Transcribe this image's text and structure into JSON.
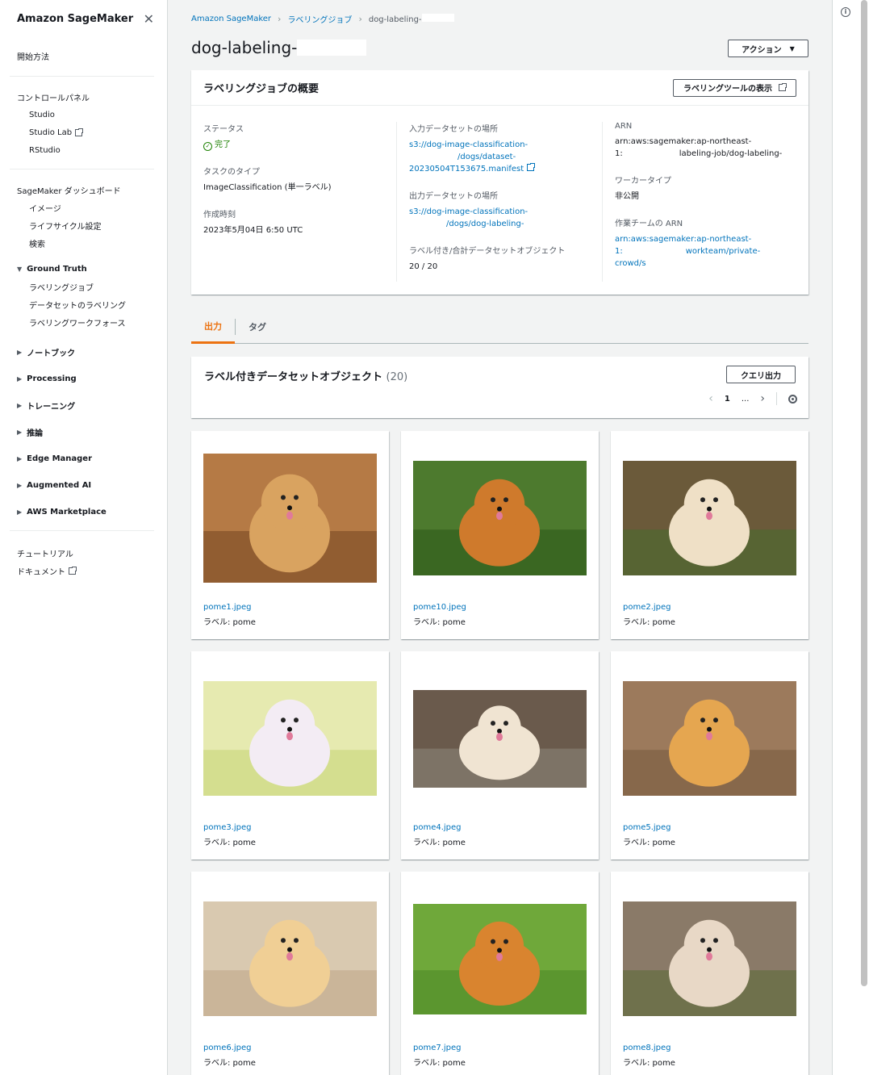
{
  "sidebar": {
    "title": "Amazon SageMaker",
    "getting_started": "開始方法",
    "control_panel": "コントロールパネル",
    "control_items": [
      "Studio",
      "Studio Lab",
      "RStudio"
    ],
    "dashboard": "SageMaker ダッシュボード",
    "dashboard_items": [
      "イメージ",
      "ライフサイクル設定",
      "検索"
    ],
    "ground_truth": "Ground Truth",
    "gt_items": [
      "ラベリングジョブ",
      "データセットのラベリング",
      "ラベリングワークフォース"
    ],
    "sections": [
      "ノートブック",
      "Processing",
      "トレーニング",
      "推論",
      "Edge Manager",
      "Augmented AI",
      "AWS Marketplace"
    ],
    "tutorial": "チュートリアル",
    "docs": "ドキュメント"
  },
  "breadcrumb": {
    "root": "Amazon SageMaker",
    "jobs": "ラベリングジョブ",
    "current": "dog-labeling-"
  },
  "page": {
    "title": "dog-labeling-",
    "actions": "アクション"
  },
  "overview": {
    "title": "ラベリングジョブの概要",
    "view_tool": "ラベリングツールの表示",
    "status_label": "ステータス",
    "status_value": "完了",
    "task_type_label": "タスクのタイプ",
    "task_type_value": "ImageClassification (単一ラベル)",
    "created_label": "作成時刻",
    "created_value": "2023年5月04日 6:50 UTC",
    "input_label": "入力データセットの場所",
    "input_line1": "s3://dog-image-classification-",
    "input_line2": "/dogs/dataset-",
    "input_line3": "20230504T153675.manifest",
    "output_label": "出力データセットの場所",
    "output_line1": "s3://dog-image-classification-",
    "output_line2": "/dogs/dog-labeling-",
    "objects_label": "ラベル付き/合計データセットオブジェクト",
    "objects_value": "20 / 20",
    "arn_label": "ARN",
    "arn_line1": "arn:aws:sagemaker:ap-northeast-",
    "arn_line2a": "1:",
    "arn_line2b": "labeling-job/dog-labeling-",
    "worker_label": "ワーカータイプ",
    "worker_value": "非公開",
    "team_label": "作業チームの ARN",
    "team_line1": "arn:aws:sagemaker:ap-northeast-",
    "team_line2a": "1:",
    "team_line2b": "workteam/private-",
    "team_line3": "crowd/s"
  },
  "tabs": {
    "output": "出力",
    "tags": "タグ"
  },
  "results": {
    "title": "ラベル付きデータセットオブジェクト",
    "count": "(20)",
    "query": "クエリ出力",
    "page": "1",
    "ellipsis": "..."
  },
  "label_prefix": "ラベル: pome",
  "items": [
    {
      "name": "pome1.jpeg"
    },
    {
      "name": "pome10.jpeg"
    },
    {
      "name": "pome2.jpeg"
    },
    {
      "name": "pome3.jpeg"
    },
    {
      "name": "pome4.jpeg"
    },
    {
      "name": "pome5.jpeg"
    },
    {
      "name": "pome6.jpeg"
    },
    {
      "name": "pome7.jpeg"
    },
    {
      "name": "pome8.jpeg"
    }
  ]
}
